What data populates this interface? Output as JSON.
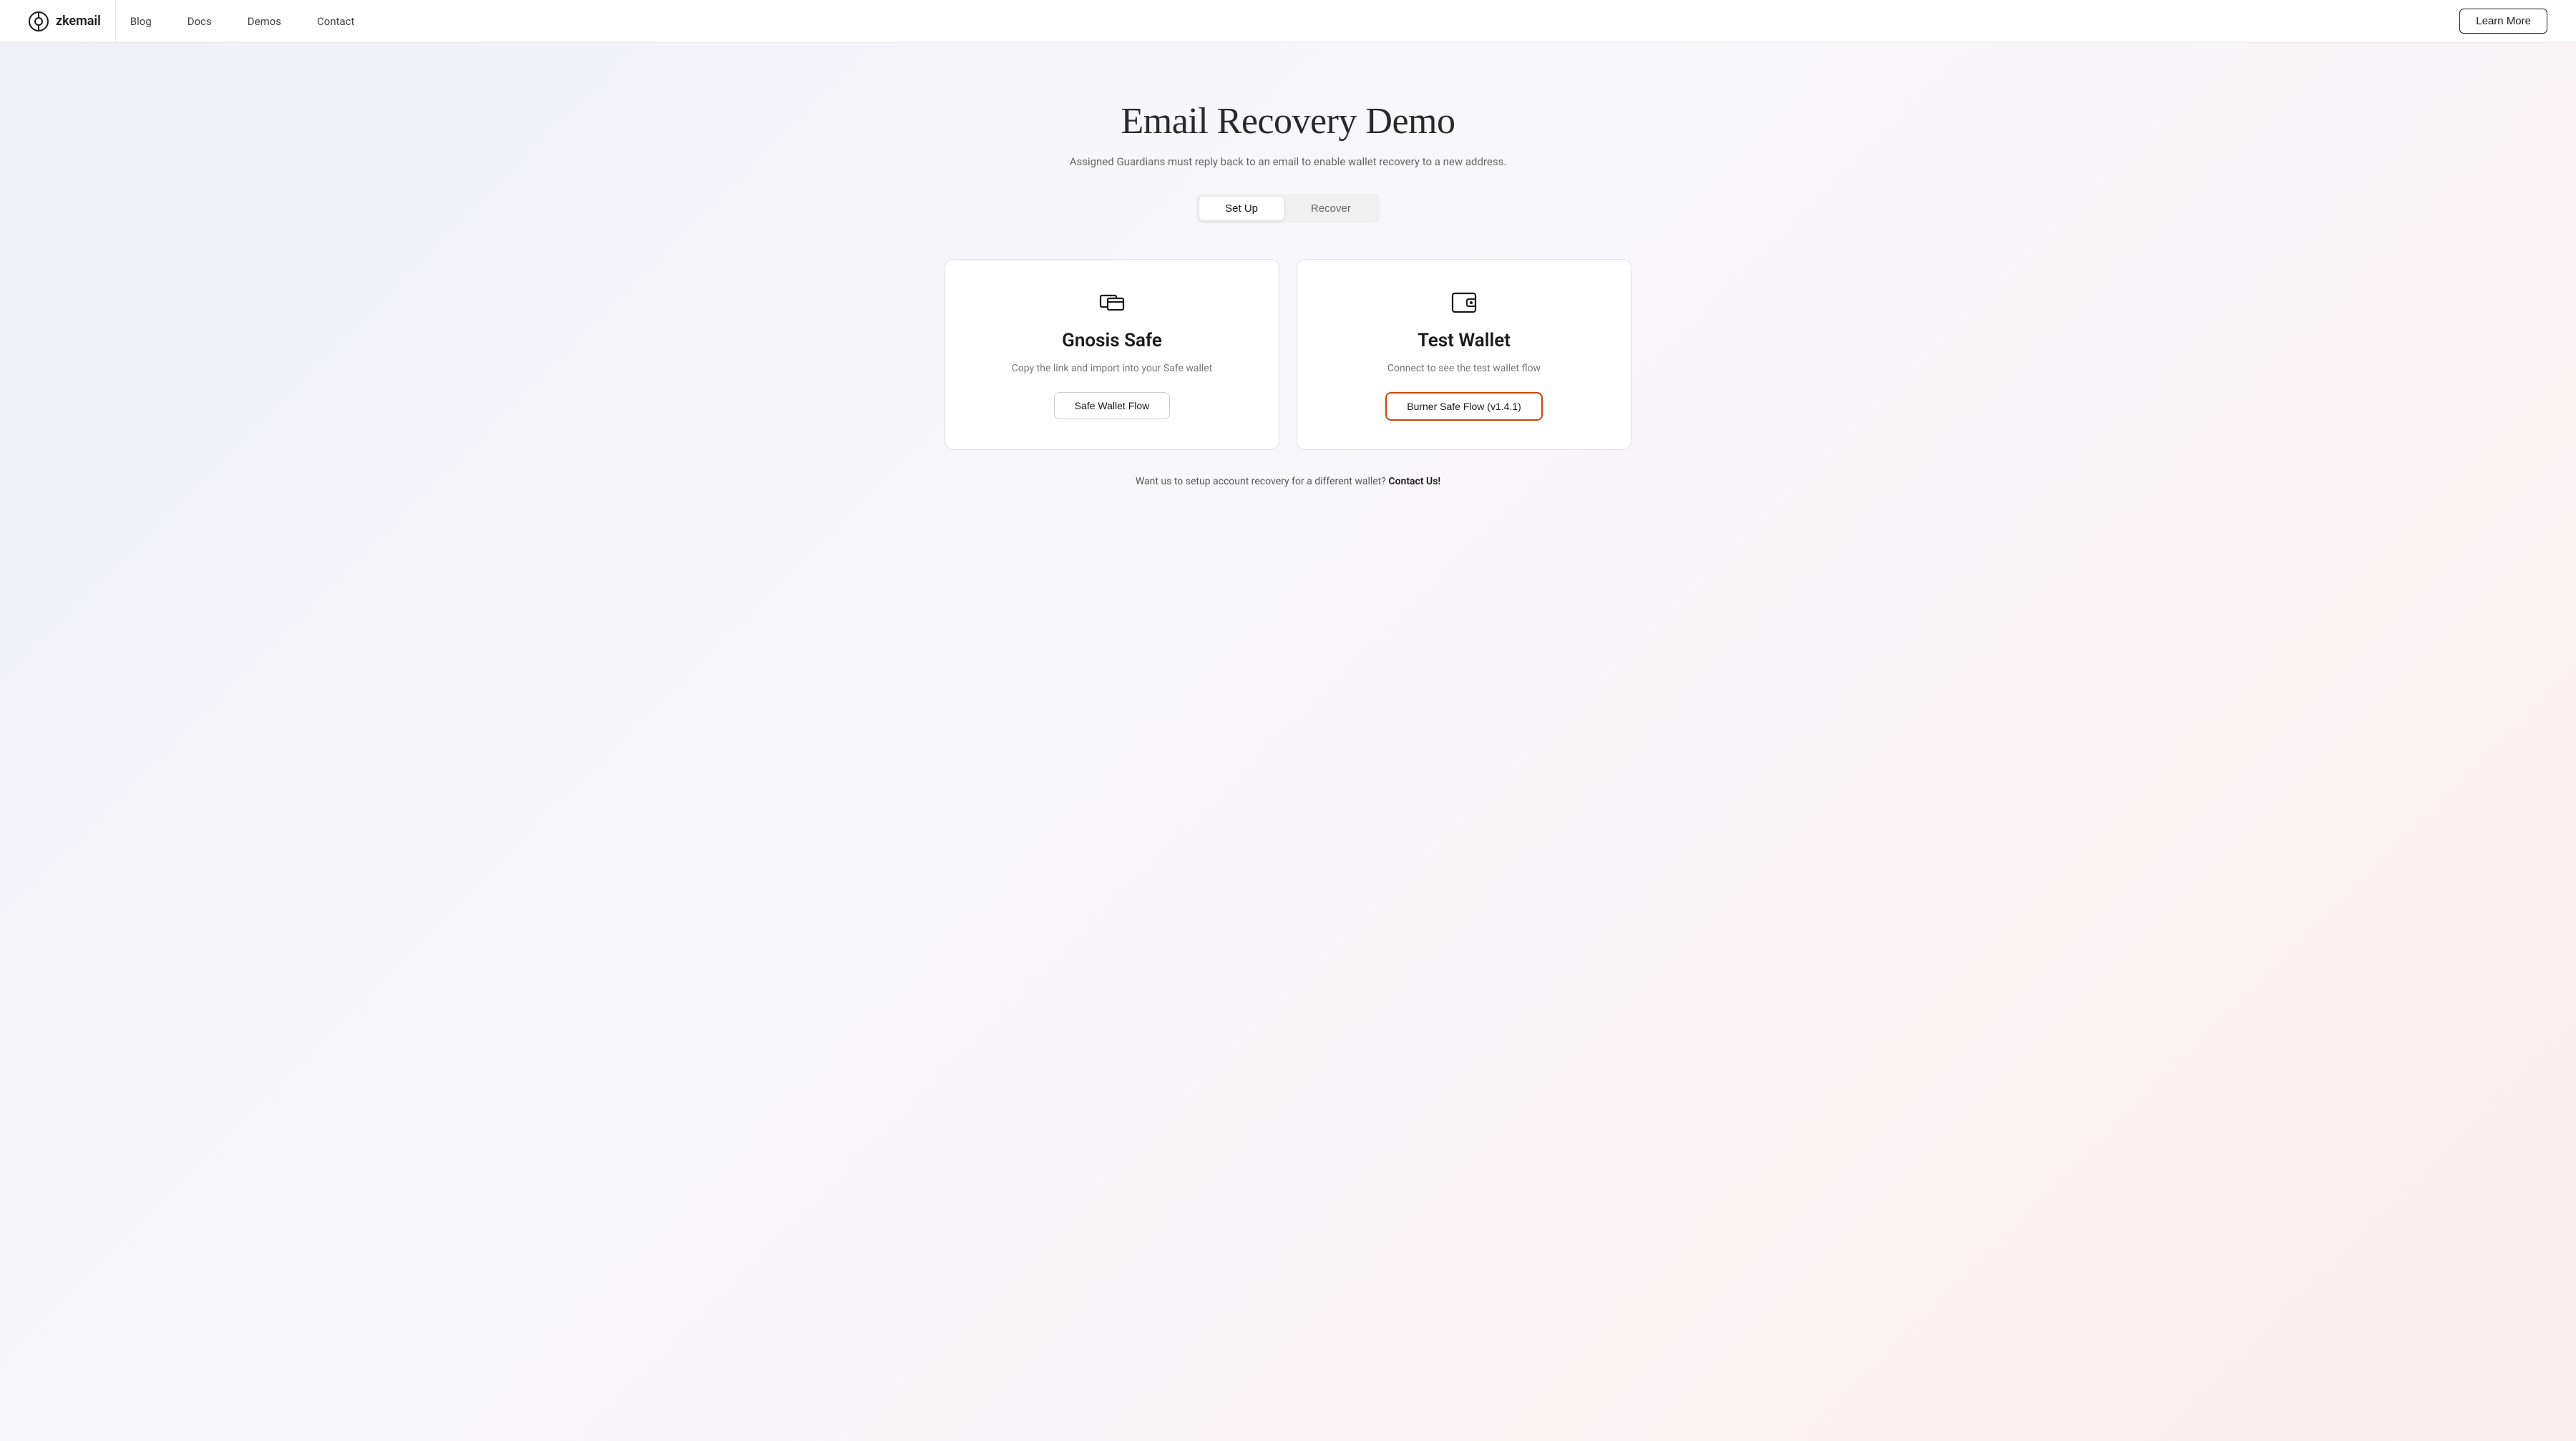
{
  "navbar": {
    "logo_text": "zkemail",
    "links": [
      {
        "label": "Blog",
        "id": "blog"
      },
      {
        "label": "Docs",
        "id": "docs"
      },
      {
        "label": "Demos",
        "id": "demos"
      },
      {
        "label": "Contact",
        "id": "contact"
      }
    ],
    "learn_more_label": "Learn More"
  },
  "hero": {
    "title": "Email Recovery Demo",
    "subtitle": "Assigned Guardians must reply back to an email to enable wallet recovery to a new address."
  },
  "tabs": [
    {
      "label": "Set Up",
      "id": "setup",
      "active": true
    },
    {
      "label": "Recover",
      "id": "recover",
      "active": false
    }
  ],
  "cards": [
    {
      "id": "gnosis-safe",
      "title": "Gnosis Safe",
      "description": "Copy the link and import into your Safe wallet",
      "button_label": "Safe Wallet Flow",
      "highlighted": false
    },
    {
      "id": "test-wallet",
      "title": "Test Wallet",
      "description": "Connect to see the test wallet flow",
      "button_label": "Burner Safe Flow (v1.4.1)",
      "highlighted": true
    }
  ],
  "footer": {
    "text": "Want us to setup account recovery for a different wallet?",
    "link_label": "Contact Us",
    "exclamation": "!"
  }
}
